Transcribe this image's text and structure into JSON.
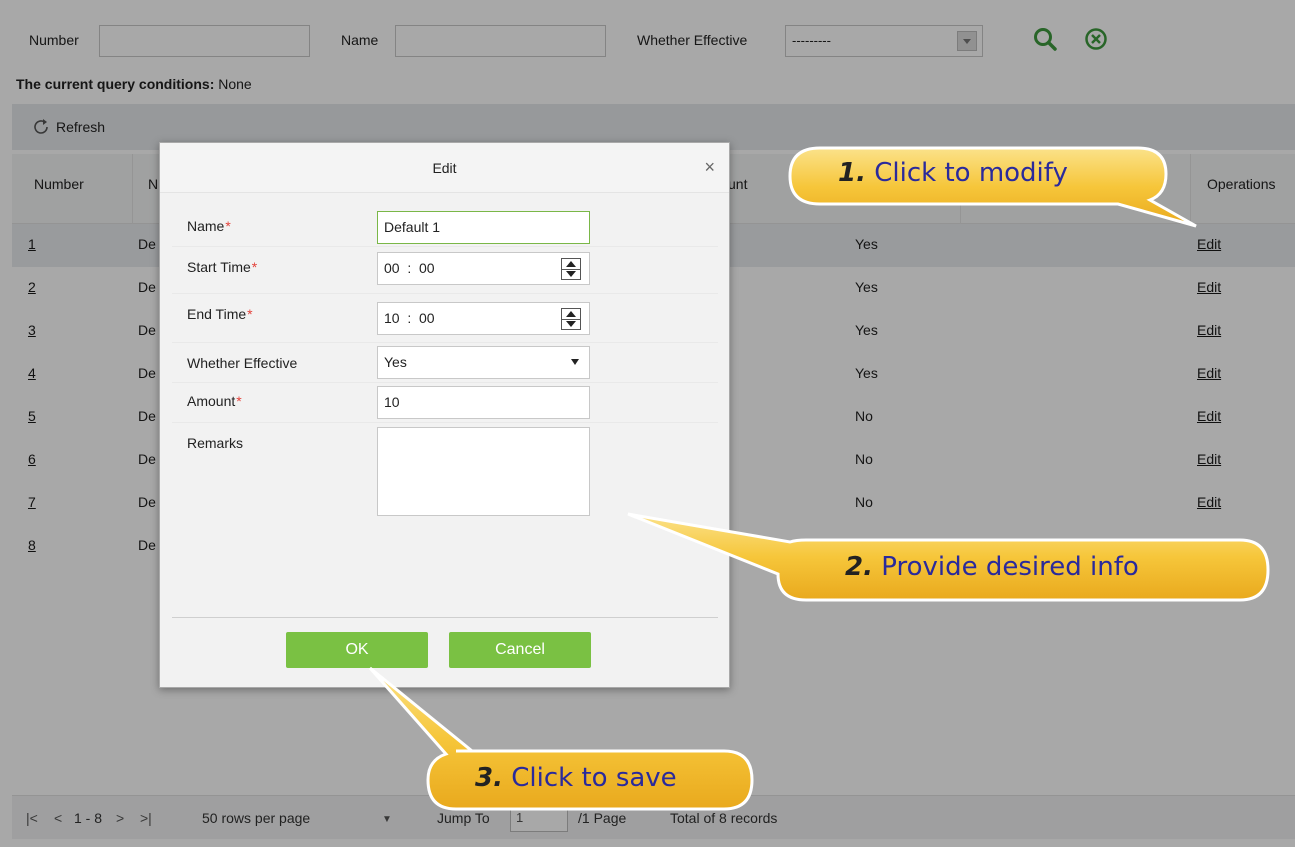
{
  "filter": {
    "number_label": "Number",
    "name_label": "Name",
    "effective_label": "Whether Effective",
    "effective_value": "---------"
  },
  "query": {
    "label": "The current query conditions:",
    "value": "None"
  },
  "toolbar": {
    "refresh_label": "Refresh"
  },
  "grid": {
    "headers": {
      "number": "Number",
      "name_fragment": "N",
      "amount_fragment": "unt",
      "operations": "Operations"
    },
    "rows": [
      {
        "number": "1",
        "name": "De",
        "effective": "Yes",
        "op": "Edit"
      },
      {
        "number": "2",
        "name": "De",
        "effective": "Yes",
        "op": "Edit"
      },
      {
        "number": "3",
        "name": "De",
        "effective": "Yes",
        "op": "Edit"
      },
      {
        "number": "4",
        "name": "De",
        "effective": "Yes",
        "op": "Edit"
      },
      {
        "number": "5",
        "name": "De",
        "effective": "No",
        "op": "Edit"
      },
      {
        "number": "6",
        "name": "De",
        "effective": "No",
        "op": "Edit"
      },
      {
        "number": "7",
        "name": "De",
        "effective": "No",
        "op": "Edit"
      },
      {
        "number": "8",
        "name": "De",
        "effective": "",
        "op": ""
      }
    ]
  },
  "pager": {
    "first": "|<",
    "prev": "<",
    "range": "1 - 8",
    "next": ">",
    "last": ">|",
    "rows_per_page": "50 rows per page",
    "jump_label": "Jump To",
    "jump_value": "1",
    "page_info": "/1 Page",
    "total": "Total of 8 records"
  },
  "modal": {
    "title": "Edit",
    "close": "×",
    "fields": {
      "name": {
        "label": "Name",
        "value": "Default 1"
      },
      "start_time": {
        "label": "Start Time",
        "value": "00  :  00"
      },
      "end_time": {
        "label": "End Time",
        "value": "10  :  00"
      },
      "effective": {
        "label": "Whether Effective",
        "value": "Yes"
      },
      "amount": {
        "label": "Amount",
        "value": "10"
      },
      "remarks": {
        "label": "Remarks",
        "value": ""
      }
    },
    "required_mark": "*",
    "ok_label": "OK",
    "cancel_label": "Cancel"
  },
  "callouts": {
    "c1": {
      "num": "1.",
      "text": "Click to modify"
    },
    "c2": {
      "num": "2.",
      "text": "Provide desired info"
    },
    "c3": {
      "num": "3.",
      "text": "Click to save"
    }
  },
  "colors": {
    "accent_green": "#7ac143",
    "callout_yellow": "#f7c431",
    "callout_text": "#2a2a9c"
  }
}
